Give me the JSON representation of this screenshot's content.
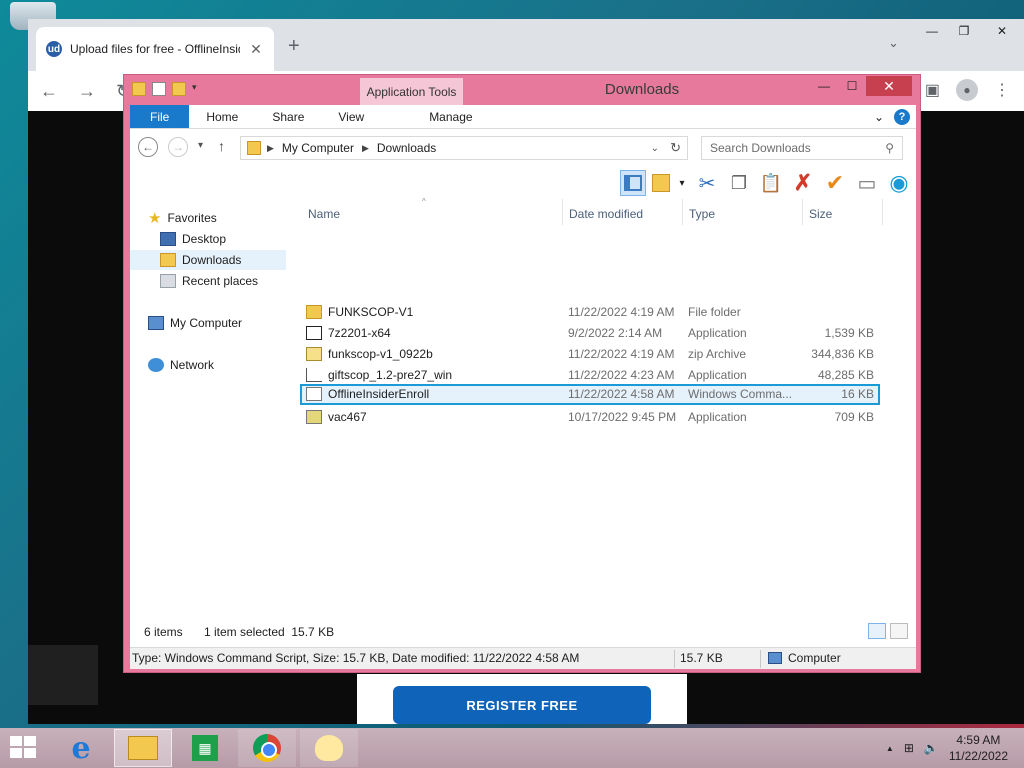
{
  "browser": {
    "tab_title": "Upload files for free - OfflineInsiderEnroll - ufile.io",
    "tab_close": "✕",
    "new_tab": "+",
    "tab_list": "⌄",
    "back": "←",
    "forward": "→",
    "reload": "↻",
    "favicon": "ud",
    "window_controls": [
      "—",
      "❐",
      "✕"
    ]
  },
  "webpage": {
    "register_button": "REGISTER FREE"
  },
  "explorer": {
    "window_title": "Downloads",
    "context_tab": "Application Tools",
    "window_controls": [
      "—",
      "☐",
      "✕"
    ],
    "ribbon_tabs": [
      "File",
      "Home",
      "Share",
      "View",
      "Manage"
    ],
    "ribbon_expand": "⌄",
    "help": "?",
    "nav": {
      "back": "←",
      "forward": "→",
      "recent": "▾",
      "up": "↑"
    },
    "address": {
      "segments": [
        "My Computer",
        "Downloads"
      ],
      "separator": "▶",
      "dropdown": "⌄",
      "refresh": "↻"
    },
    "search_placeholder": "Search Downloads",
    "search_icon": "⚲",
    "toolbar_icons": [
      "preview-pane-icon",
      "new-folder-icon",
      "cut-icon",
      "copy-icon",
      "paste-icon",
      "delete-icon",
      "properties-icon",
      "rename-icon",
      "globe-icon"
    ],
    "toolbar_glyphs": {
      "more": "▾",
      "cut": "✂",
      "copy": "❐",
      "paste": "📋",
      "delete": "✗",
      "check": "✔",
      "rename": "▭",
      "globe": "◉"
    },
    "sidebar": {
      "favorites_label": "Favorites",
      "favorites": [
        "Desktop",
        "Downloads",
        "Recent places"
      ],
      "computer": "My Computer",
      "network": "Network",
      "selected": "Downloads"
    },
    "columns": [
      "Name",
      "Date modified",
      "Type",
      "Size"
    ],
    "sort_arrow": "^",
    "files": [
      {
        "name": "FUNKSCOP-V1",
        "date": "11/22/2022 4:19 AM",
        "type": "File folder",
        "size": "",
        "icon": "folder-icon"
      },
      {
        "name": "7z2201-x64",
        "date": "9/2/2022 2:14 AM",
        "type": "Application",
        "size": "1,539 KB",
        "icon": "7zip-icon"
      },
      {
        "name": "funkscop-v1_0922b",
        "date": "11/22/2022 4:19 AM",
        "type": "zip Archive",
        "size": "344,836 KB",
        "icon": "zip-icon"
      },
      {
        "name": "giftscop_1.2-pre27_win",
        "date": "11/22/2022 4:23 AM",
        "type": "Application",
        "size": "48,285 KB",
        "icon": "app-icon"
      },
      {
        "name": "OfflineInsiderEnroll",
        "date": "11/22/2022 4:58 AM",
        "type": "Windows Comma...",
        "size": "16 KB",
        "icon": "cmd-script-icon"
      },
      {
        "name": "vac467",
        "date": "10/17/2022 9:45 PM",
        "type": "Application",
        "size": "709 KB",
        "icon": "installer-icon"
      }
    ],
    "selected_file": "OfflineInsiderEnroll",
    "status": {
      "items": "6 items",
      "selection": "1 item selected  15.7 KB",
      "details": "Type: Windows Command Script, Size: 15.7 KB, Date modified: 11/22/2022 4:58 AM",
      "size": "15.7 KB",
      "location": "Computer"
    }
  },
  "taskbar": {
    "apps": [
      "internet-explorer",
      "file-explorer",
      "store",
      "chrome",
      "misc-app"
    ],
    "ie_glyph": "e",
    "store_glyph": "▦",
    "time": "4:59 AM",
    "date": "11/22/2022",
    "tray_up": "▲",
    "tray_network": "⊞",
    "tray_volume": "🔈"
  },
  "colors": {
    "explorer_frame": "#e7799d",
    "selection_border": "#1a9ad6",
    "file_tab": "#1979ca",
    "close_button": "#c7404f"
  }
}
